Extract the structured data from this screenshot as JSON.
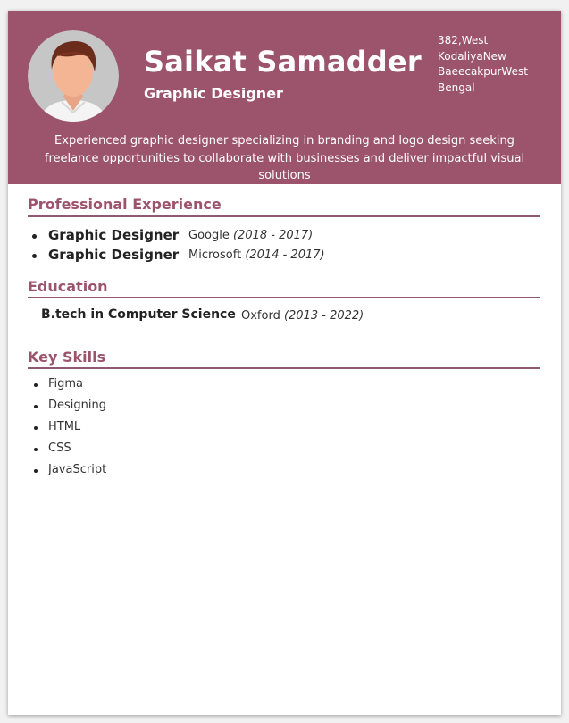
{
  "header": {
    "name": "Saikat Samadder",
    "title": "Graphic Designer",
    "address_lines": [
      "382,West",
      "KodaliyaNew",
      "BaeecakpurWest",
      "Bengal"
    ],
    "summary": "Experienced graphic designer specializing in branding and logo design seeking freelance opportunities to collaborate with businesses and deliver impactful visual solutions"
  },
  "sections": {
    "experience": {
      "title": "Professional Experience",
      "items": [
        {
          "role": "Graphic Designer",
          "company": "Google",
          "years": "(2018 - 2017)"
        },
        {
          "role": "Graphic Designer",
          "company": "Microsoft",
          "years": "(2014 - 2017)"
        }
      ]
    },
    "education": {
      "title": "Education",
      "degree": "B.tech in Computer Science",
      "school": "Oxford",
      "years": "(2013 - 2022)"
    },
    "skills": {
      "title": "Key Skills",
      "items": [
        "Figma",
        "Designing",
        "HTML",
        "CSS",
        "JavaScript"
      ]
    }
  },
  "colors": {
    "accent": "#9c546d",
    "rule": "#8e5a73",
    "page_background": "#f1f1f1"
  },
  "icons": {
    "avatar": "person-avatar-icon"
  }
}
